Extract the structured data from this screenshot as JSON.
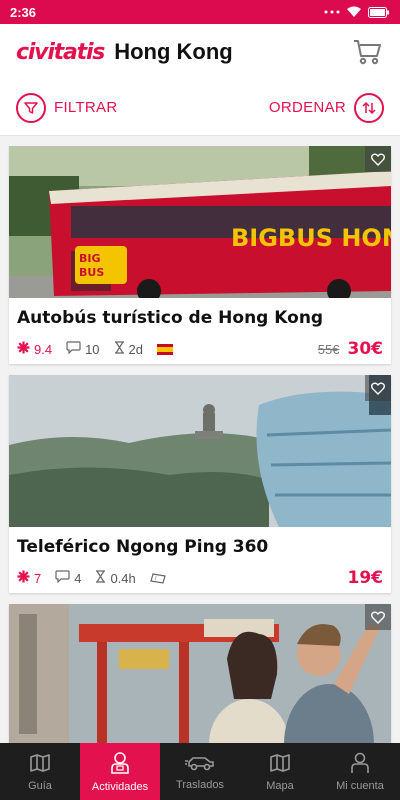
{
  "status_bar": {
    "time": "2:36",
    "battery_icon": "battery-icon",
    "wifi_icon": "wifi-icon"
  },
  "header": {
    "brand": "civitatis",
    "city": "Hong Kong",
    "cart_icon": "cart-icon"
  },
  "filter_bar": {
    "filter_label": "FILTRAR",
    "sort_label": "ORDENAR"
  },
  "colors": {
    "brand": "#e4114f",
    "status_bar": "#dc0a4f",
    "nav_bg": "#1e1e1e"
  },
  "activities": [
    {
      "title": "Autobús turístico de Hong Kong",
      "image_text": "BIGBUS HONG K",
      "rating": "9.4",
      "reviews": "10",
      "duration": "2d",
      "language_flag": "spain-flag-icon",
      "old_price": "55€",
      "price": "30€"
    },
    {
      "title": "Teleférico Ngong Ping 360",
      "rating": "7",
      "reviews": "4",
      "duration": "0.4h",
      "ticket_icon": "ticket-icon",
      "price": "19€"
    },
    {
      "title": ""
    }
  ],
  "bottom_nav": [
    {
      "label": "Guía",
      "icon": "map-book-icon",
      "active": false
    },
    {
      "label": "Actividades",
      "icon": "person-activity-icon",
      "active": true
    },
    {
      "label": "Traslados",
      "icon": "car-icon",
      "active": false
    },
    {
      "label": "Mapa",
      "icon": "map-icon",
      "active": false
    },
    {
      "label": "Mi cuenta",
      "icon": "user-icon",
      "active": false
    }
  ]
}
